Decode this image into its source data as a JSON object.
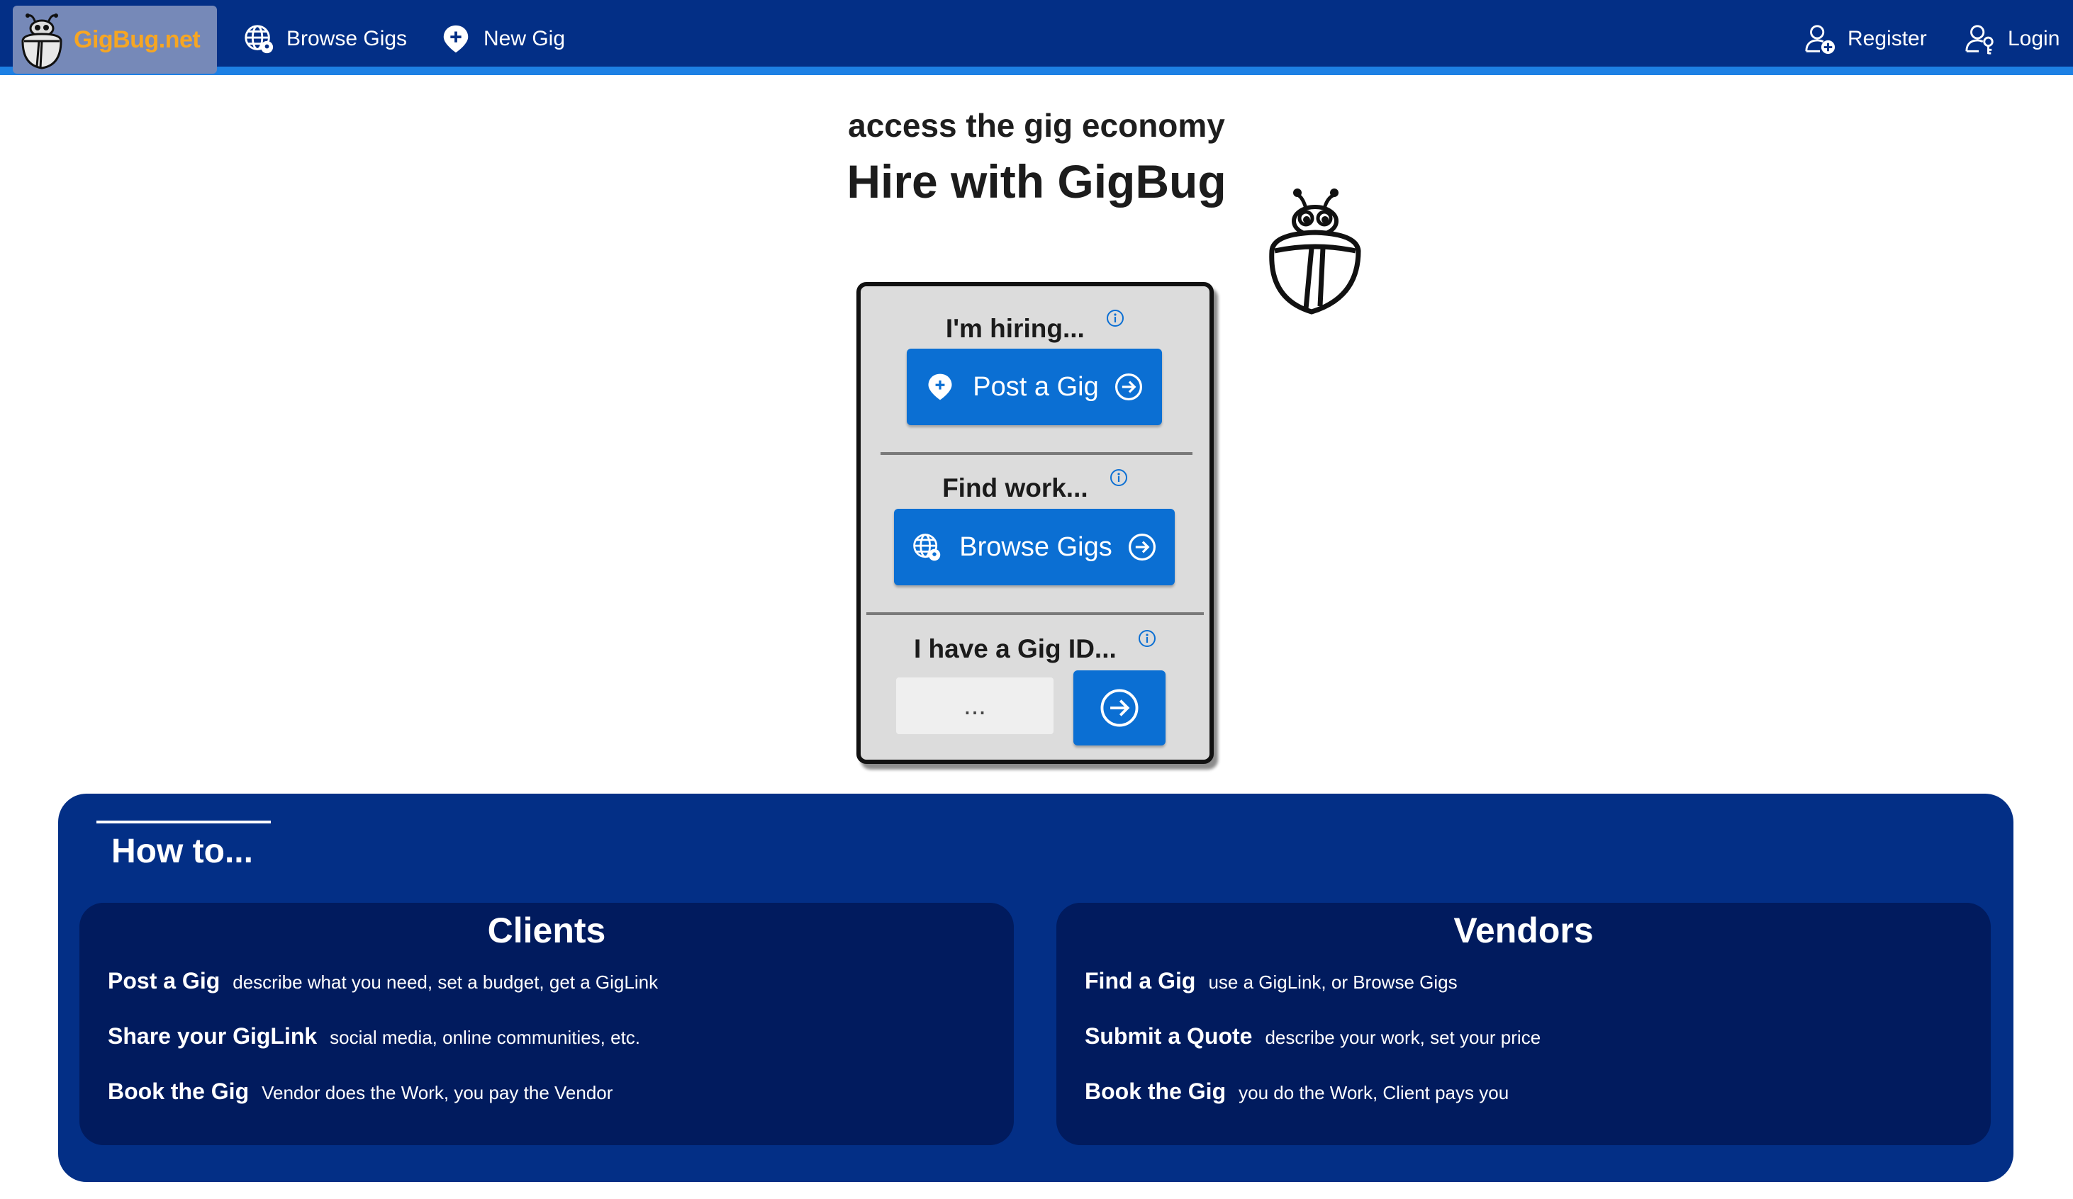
{
  "nav": {
    "brand": "GigBug.net",
    "browse_gigs": "Browse Gigs",
    "new_gig": "New Gig",
    "register": "Register",
    "login": "Login"
  },
  "hero": {
    "eyebrow": "access the gig economy",
    "title": "Hire with GigBug"
  },
  "card": {
    "hiring_label": "I'm hiring...",
    "post_gig_button": "Post a Gig",
    "find_work_label": "Find work...",
    "browse_gigs_button": "Browse Gigs",
    "gig_id_label": "I have a Gig ID...",
    "gig_id_placeholder": "...",
    "gig_id_value": ""
  },
  "howto": {
    "title": "How to...",
    "clients": {
      "title": "Clients",
      "steps": [
        {
          "name": "Post a Gig",
          "desc": "describe what you need, set a budget, get a GigLink"
        },
        {
          "name": "Share your GigLink",
          "desc": "social media, online communities, etc."
        },
        {
          "name": "Book the Gig",
          "desc": "Vendor does the Work, you pay the Vendor"
        }
      ]
    },
    "vendors": {
      "title": "Vendors",
      "steps": [
        {
          "name": "Find a Gig",
          "desc": "use a GigLink, or Browse Gigs"
        },
        {
          "name": "Submit a Quote",
          "desc": "describe your work, set your price"
        },
        {
          "name": "Book the Gig",
          "desc": "you do the Work, Client pays you"
        }
      ]
    }
  },
  "colors": {
    "nav_bg": "#032f86",
    "nav_accent": "#1d80e4",
    "brand_text": "#f6a623",
    "button_blue": "#0b6fd3",
    "panel_bg": "#032f86",
    "column_bg": "#011b5e"
  },
  "icons": {
    "brand": "gigbug-logo",
    "browse": "globe-location-icon",
    "new_gig": "map-pin-plus-icon",
    "register": "user-plus-icon",
    "login": "user-key-icon",
    "info": "info-circle-icon",
    "arrow": "arrow-right-circle-icon"
  }
}
